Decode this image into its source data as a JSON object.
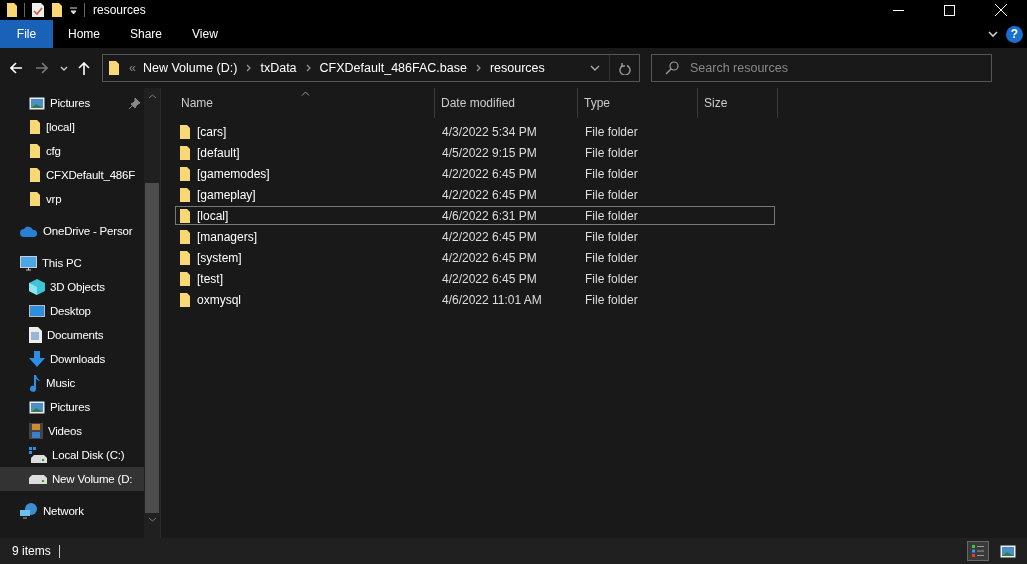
{
  "window": {
    "title": "resources"
  },
  "ribbon": {
    "tabs": [
      {
        "label": "File",
        "kind": "file"
      },
      {
        "label": "Home",
        "kind": "tab"
      },
      {
        "label": "Share",
        "kind": "tab"
      },
      {
        "label": "View",
        "kind": "tab"
      }
    ],
    "help": "?"
  },
  "address_bar": {
    "overflow": "«",
    "crumbs": [
      "New Volume (D:)",
      "txData",
      "CFXDefault_486FAC.base",
      "resources"
    ]
  },
  "search": {
    "placeholder": "Search resources"
  },
  "sidebar": {
    "quick_access": [
      {
        "label": "Pictures",
        "kind": "pictures",
        "pinned": true
      },
      {
        "label": "[local]",
        "kind": "folder",
        "pinned": false
      },
      {
        "label": "cfg",
        "kind": "folder",
        "pinned": false
      },
      {
        "label": "CFXDefault_486F",
        "kind": "folder",
        "pinned": false
      },
      {
        "label": "vrp",
        "kind": "folder",
        "pinned": false
      }
    ],
    "tree": [
      {
        "label": "OneDrive - Persor",
        "kind": "cloud",
        "selected": false
      },
      {
        "label": "This PC",
        "kind": "pc",
        "selected": false,
        "children": [
          {
            "label": "3D Objects",
            "kind": "cube",
            "selected": false
          },
          {
            "label": "Desktop",
            "kind": "desktop",
            "selected": false
          },
          {
            "label": "Documents",
            "kind": "documents",
            "selected": false
          },
          {
            "label": "Downloads",
            "kind": "downloads",
            "selected": false
          },
          {
            "label": "Music",
            "kind": "music",
            "selected": false
          },
          {
            "label": "Pictures",
            "kind": "pictures",
            "selected": false
          },
          {
            "label": "Videos",
            "kind": "videos",
            "selected": false
          },
          {
            "label": "Local Disk (C:)",
            "kind": "windisk",
            "selected": false
          },
          {
            "label": "New Volume (D:",
            "kind": "disk",
            "selected": true
          }
        ]
      },
      {
        "label": "Network",
        "kind": "network",
        "selected": false
      }
    ]
  },
  "table": {
    "columns": [
      "Name",
      "Date modified",
      "Type",
      "Size"
    ],
    "rows": [
      {
        "name": "[cars]",
        "date": "4/3/2022 5:34 PM",
        "type": "File folder",
        "focused": false
      },
      {
        "name": "[default]",
        "date": "4/5/2022 9:15 PM",
        "type": "File folder",
        "focused": false
      },
      {
        "name": "[gamemodes]",
        "date": "4/2/2022 6:45 PM",
        "type": "File folder",
        "focused": false
      },
      {
        "name": "[gameplay]",
        "date": "4/2/2022 6:45 PM",
        "type": "File folder",
        "focused": false
      },
      {
        "name": "[local]",
        "date": "4/6/2022 6:31 PM",
        "type": "File folder",
        "focused": true
      },
      {
        "name": "[managers]",
        "date": "4/2/2022 6:45 PM",
        "type": "File folder",
        "focused": false
      },
      {
        "name": "[system]",
        "date": "4/2/2022 6:45 PM",
        "type": "File folder",
        "focused": false
      },
      {
        "name": "[test]",
        "date": "4/2/2022 6:45 PM",
        "type": "File folder",
        "focused": false
      },
      {
        "name": "oxmysql",
        "date": "4/6/2022 11:01 AM",
        "type": "File folder",
        "focused": false
      }
    ]
  },
  "status_bar": {
    "count": "9 items",
    "views": [
      {
        "kind": "details",
        "selected": true
      },
      {
        "kind": "large_icons",
        "selected": false
      }
    ]
  }
}
